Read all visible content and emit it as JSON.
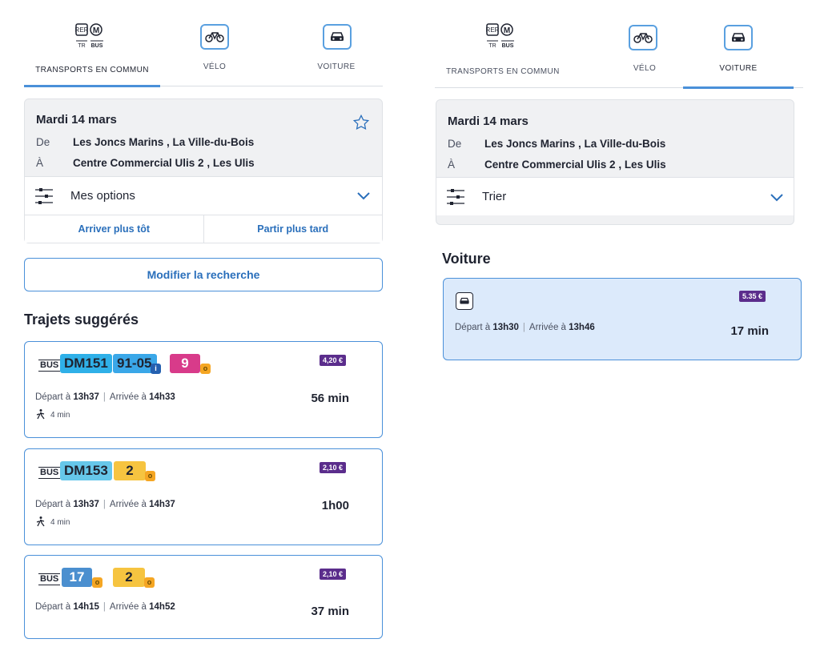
{
  "left": {
    "tabs": [
      {
        "label": "TRANSPORTS EN COMMUN",
        "active": true,
        "icon": "transit-icon"
      },
      {
        "label": "VÉLO",
        "active": false,
        "icon": "bike-icon"
      },
      {
        "label": "VOITURE",
        "active": false,
        "icon": "car-icon"
      }
    ],
    "summary": {
      "date": "Mardi 14 mars",
      "from_key": "De",
      "from": "Les Joncs Marins , La Ville-du-Bois",
      "to_key": "À",
      "to": "Centre Commercial Ulis 2 , Les Ulis",
      "options_label": "Mes options",
      "earlier": "Arriver plus tôt",
      "later": "Partir plus tard"
    },
    "modify_label": "Modifier la recherche",
    "section_title": "Trajets suggérés",
    "trips": [
      {
        "mode": "BUS",
        "lines": [
          {
            "name": "DM151",
            "color": "#2fb0e8"
          },
          {
            "name": "91-05",
            "color": "#3aa7e8",
            "sub": "i"
          },
          {
            "name": "9",
            "color": "#d83b8a",
            "sub": "o"
          }
        ],
        "price": "4,20 €",
        "depart_prefix": "Départ à ",
        "depart": "13h37",
        "arrive_prefix": "Arrivée à ",
        "arrive": "14h33",
        "duration": "56 min",
        "walk": "4 min"
      },
      {
        "mode": "BUS",
        "lines": [
          {
            "name": "DM153",
            "color": "#66c7ea"
          },
          {
            "name": "2",
            "color": "#f6c440",
            "sub": "o"
          }
        ],
        "price": "2,10 €",
        "depart_prefix": "Départ à ",
        "depart": "13h37",
        "arrive_prefix": "Arrivée à ",
        "arrive": "14h37",
        "duration": "1h00",
        "walk": "4 min"
      },
      {
        "mode": "BUS",
        "lines": [
          {
            "name": "17",
            "color": "#4b8fcf",
            "sub": "o"
          },
          {
            "name": "2",
            "color": "#f6c440",
            "sub": "o"
          }
        ],
        "price": "2,10 €",
        "depart_prefix": "Départ à ",
        "depart": "14h15",
        "arrive_prefix": "Arrivée à ",
        "arrive": "14h52",
        "duration": "37 min"
      }
    ]
  },
  "right": {
    "tabs": [
      {
        "label": "TRANSPORTS EN COMMUN",
        "active": false,
        "icon": "transit-icon"
      },
      {
        "label": "VÉLO",
        "active": false,
        "icon": "bike-icon"
      },
      {
        "label": "VOITURE",
        "active": true,
        "icon": "car-icon"
      }
    ],
    "summary": {
      "date": "Mardi 14 mars",
      "from_key": "De",
      "from": "Les Joncs Marins , La Ville-du-Bois",
      "to_key": "À",
      "to": "Centre Commercial Ulis 2 , Les Ulis",
      "options_label": "Trier"
    },
    "section_title": "Voiture",
    "car_trip": {
      "price": "5.35 €",
      "depart_prefix": "Départ à ",
      "depart": "13h30",
      "arrive_prefix": "Arrivée à ",
      "arrive": "13h46",
      "duration": "17 min"
    }
  },
  "colors": {
    "accent": "#4a90d9",
    "price_bg": "#5b2d8c",
    "selected_bg": "#dceafb"
  }
}
